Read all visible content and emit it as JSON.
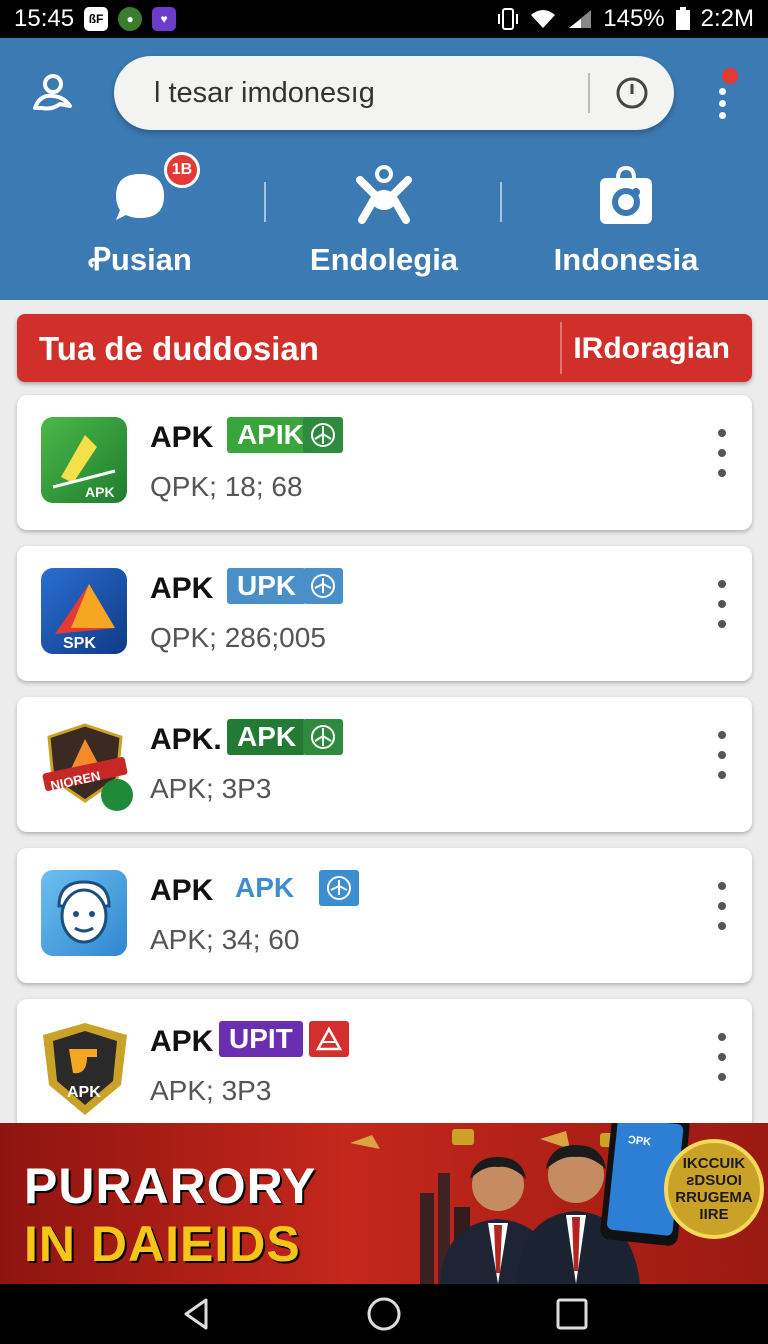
{
  "status_bar": {
    "time": "15:45",
    "battery": "145%",
    "right_time": "2:2M",
    "icons": [
      "notification-app-icon",
      "notification-app-icon",
      "notification-app-icon",
      "vibrate-icon",
      "wifi-icon",
      "signal-icon",
      "battery-icon"
    ]
  },
  "header": {
    "search_text": "l tesar imdonesıg",
    "tabs": [
      {
        "label": "Ꝓusian",
        "icon": "chat-bubble-icon",
        "badge": "1B"
      },
      {
        "label": "Endolegia",
        "icon": "person-icon"
      },
      {
        "label": "Indonesia",
        "icon": "shopping-bag-icon"
      }
    ]
  },
  "section_bar": {
    "title": "Tua de duddosian",
    "action": "IRdoragian",
    "color": "#d02f2a"
  },
  "apps": [
    {
      "name": "APK",
      "tag": "APIK",
      "tag_color": "#3aa53a",
      "tag_icon_color": "#2e8b3e",
      "subtitle": "QPK; 18; 68",
      "icon_label": "APK",
      "icon": "green-arrow-app-icon"
    },
    {
      "name": "APK",
      "tag": "UPK",
      "tag_color": "#4a90c8",
      "tag_icon_color": "#4a90c8",
      "subtitle": "QPK; 286;005",
      "icon_label": "SPK",
      "icon": "blue-arrow-app-icon"
    },
    {
      "name": "APK.",
      "tag": "APK",
      "tag_color": "#237a32",
      "tag_icon_color": "#2e8b3e",
      "subtitle": "APK; 3P3",
      "icon_label": "NIOREN",
      "icon": "shield-badge-app-icon"
    },
    {
      "name": "APK",
      "tag": "APK",
      "tag_color": "#3d8ed1",
      "tag_icon_color": "#3d8ed1",
      "subtitle": "APK; 34; 60",
      "icon_label": "",
      "icon": "face-app-icon"
    },
    {
      "name": "APK",
      "tag": "UPIT",
      "tag_color": "#6a2fb0",
      "tag_icon_color": "#d32f2f",
      "subtitle": "APK; 3P3",
      "icon_label": "APK",
      "icon": "gold-shield-app-icon"
    }
  ],
  "ad": {
    "line1": "PURARORY",
    "line2": "IN DAIEIDS",
    "seal_text": "IKCCUIK ƨDSUOI RRUGEMA IIRE",
    "phone_text": "ƆPK"
  },
  "nav": [
    "back-icon",
    "home-icon",
    "recents-icon"
  ]
}
